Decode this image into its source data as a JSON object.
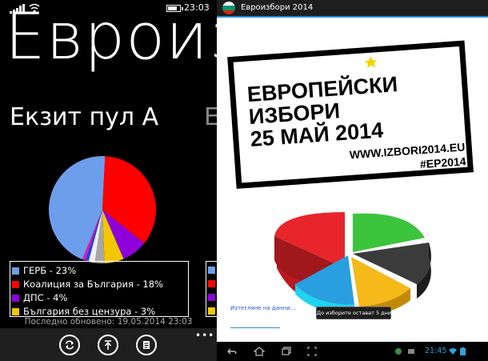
{
  "windows_phone": {
    "status_time": "23:03",
    "battery_level": 0.75,
    "app_title": "Евроизбори",
    "pivot_active": "Екзит пул А",
    "pivot_next_peek": "Е",
    "colors": {
      "gerb": "#6d9eeb",
      "koalicia": "#ff0000",
      "dps": "#8e00d9",
      "bbc": "#f3c700",
      "other1": "#a7a7a7",
      "other2": "#f0f0f0",
      "other3": "#2e3fd6",
      "other4": "#d020c0"
    },
    "legend": [
      {
        "label": "ГЕРБ - 23%",
        "color": "#6d9eeb"
      },
      {
        "label": "Коалиция за България - 18%",
        "color": "#ff0000"
      },
      {
        "label": "ДПС - 4%",
        "color": "#8e00d9"
      },
      {
        "label": "България без цензура - 3%",
        "color": "#f3c700"
      }
    ],
    "updated_text": "Последно обновено: 19.05.2014 23:03",
    "appbar_icons": [
      "refresh-icon",
      "pin-icon",
      "document-icon"
    ],
    "more_dots": "•••"
  },
  "chart_data": {
    "type": "pie",
    "title": "",
    "categories": [
      "ГЕРБ",
      "Коалиция за България",
      "ДПС",
      "България без цензура",
      "other",
      "other",
      "other",
      "other"
    ],
    "values": [
      23,
      18,
      4,
      3,
      1.5,
      1,
      0.5,
      0.5
    ],
    "colors": [
      "#6d9eeb",
      "#ff0000",
      "#8e00d9",
      "#f3c700",
      "#a7a7a7",
      "#f0f0f0",
      "#2e3fd6",
      "#d020c0"
    ]
  },
  "android": {
    "app_title": "Евроизбори 2014",
    "poster_lines": [
      "ЕВРОПЕЙСКИ",
      "ИЗБОРИ",
      "25 МАЙ 2014"
    ],
    "poster_url": "WWW.IZBORI2014.EU",
    "poster_hashtag": "#EP2014",
    "refresh_link": "Изтегляне на данни...",
    "days_button": "До изборите остават 5 дни",
    "system_time": "21:45",
    "pie3d_colors": [
      "#e8252b",
      "#3cc43c",
      "#3b3b3b",
      "#f5b91a",
      "#2a9fe0",
      "#1fd3f0"
    ]
  }
}
